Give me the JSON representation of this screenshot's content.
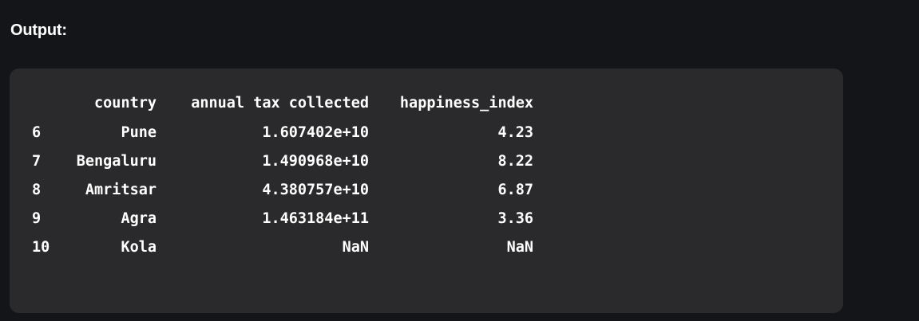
{
  "heading": "Output:",
  "dataframe": {
    "columns": [
      "country",
      "annual tax collected",
      "happiness_index"
    ],
    "rows": [
      {
        "index": "6",
        "country": "Pune",
        "tax": "1.607402e+10",
        "happiness": "4.23"
      },
      {
        "index": "7",
        "country": "Bengaluru",
        "tax": "1.490968e+10",
        "happiness": "8.22"
      },
      {
        "index": "8",
        "country": "Amritsar",
        "tax": "4.380757e+10",
        "happiness": "6.87"
      },
      {
        "index": "9",
        "country": "Agra",
        "tax": "1.463184e+11",
        "happiness": "3.36"
      },
      {
        "index": "10",
        "country": "Kola",
        "tax": "NaN",
        "happiness": "NaN"
      }
    ]
  },
  "colors": {
    "page_background": "#141518",
    "block_background": "#2a2a2c",
    "text": "#ffffff"
  }
}
